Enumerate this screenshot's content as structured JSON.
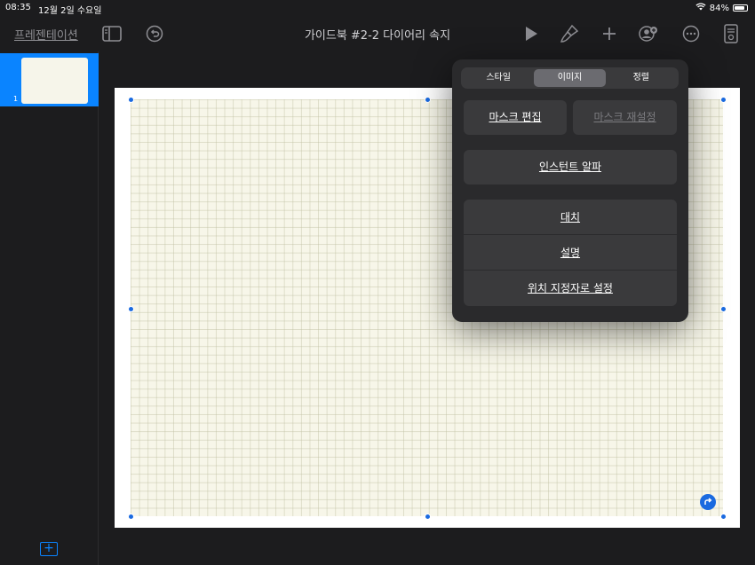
{
  "status_bar": {
    "time": "08:35",
    "date": "12월 2일 수요일",
    "battery": "84%",
    "battery_level": 0.84
  },
  "toolbar": {
    "back_label": "프레젠테이션",
    "document_title": "가이드북 #2-2 다이어리 속지",
    "icons": [
      "sidebar-icon",
      "undo-icon",
      "play-icon",
      "paintbrush-icon",
      "plus-icon",
      "collaborate-icon",
      "more-icon",
      "document-icon"
    ]
  },
  "sidebar": {
    "slides": [
      {
        "number": "1"
      }
    ],
    "add_icon": "plus-square-icon"
  },
  "popover": {
    "tabs": [
      {
        "label": "스타일",
        "active": false
      },
      {
        "label": "이미지",
        "active": true
      },
      {
        "label": "정렬",
        "active": false
      }
    ],
    "mask_edit": "마스크 편집",
    "mask_reset": "마스크 재설정",
    "instant_alpha": "인스턴트 알파",
    "group_items": [
      "대치",
      "설명",
      "위치 지정자로 설정"
    ]
  },
  "colors": {
    "accent": "#0a84ff",
    "background": "#1c1c1e",
    "paper": "#f7f6e9",
    "popover": "#2a2a2c",
    "button": "#3a3a3c"
  }
}
